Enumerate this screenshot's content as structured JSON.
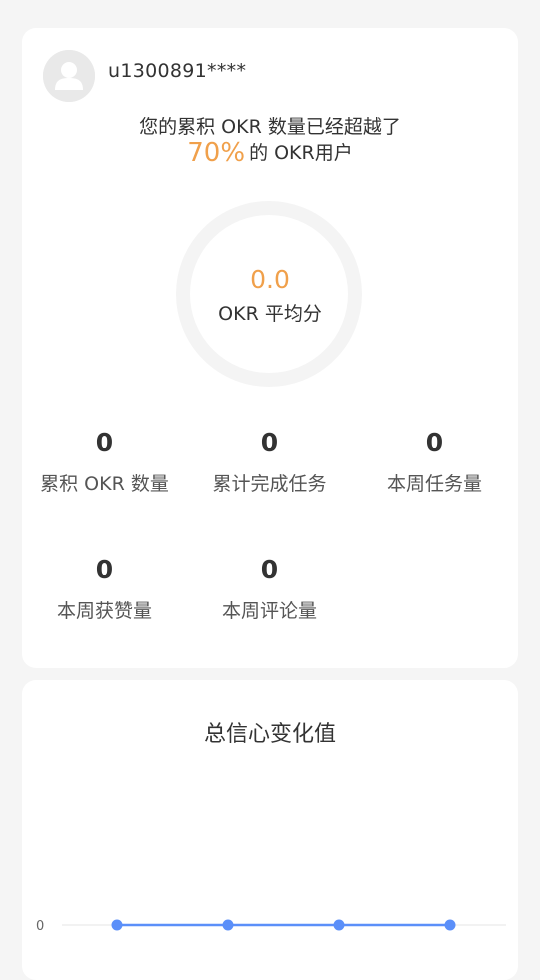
{
  "profile": {
    "username": "u1300891****",
    "headline": "您的累积 OKR 数量已经超越了",
    "percent": "70%",
    "percent_suffix": "的 OKR用户",
    "score": "0.0",
    "score_label": "OKR 平均分"
  },
  "stats": [
    {
      "value": "0",
      "label": "累积 OKR 数量"
    },
    {
      "value": "0",
      "label": "累计完成任务"
    },
    {
      "value": "0",
      "label": "本周任务量"
    },
    {
      "value": "0",
      "label": "本周获赞量"
    },
    {
      "value": "0",
      "label": "本周评论量"
    }
  ],
  "chart": {
    "title": "总信心变化值"
  },
  "chart_data": {
    "type": "line",
    "title": "总信心变化值",
    "y_ticks": [
      "0"
    ],
    "series": [
      {
        "values": [
          0,
          0,
          0,
          0
        ]
      }
    ],
    "line_color": "#5b8ff9",
    "accent_color": "#f0a04b"
  }
}
